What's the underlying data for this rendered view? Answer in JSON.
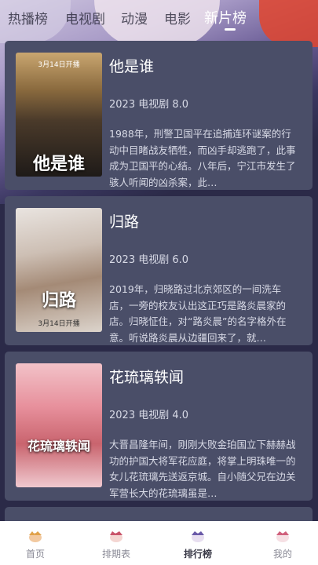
{
  "tabs": [
    {
      "label": "热播榜"
    },
    {
      "label": "电视剧"
    },
    {
      "label": "动漫"
    },
    {
      "label": "电影"
    },
    {
      "label": "新片榜",
      "active": true
    }
  ],
  "items": [
    {
      "title": "他是谁",
      "meta": "2023 电视剧 8.0",
      "desc": "1988年，刑警卫国平在追捕连环谜案的行动中目睹战友牺牲，而凶手却逃跑了，此事成为卫国平的心结。八年后，宁江市发生了骇人听闻的凶杀案，此…",
      "poster_title": "他是谁",
      "poster_date": "3月14日开播"
    },
    {
      "title": "归路",
      "meta": "2023 电视剧 6.0",
      "desc": "2019年，归晓路过北京郊区的一间洗车店，一旁的校友认出这正巧是路炎晨家的店。归晓怔住，对“路炎晨”的名字格外在意。听说路炎晨从边疆回来了，就…",
      "poster_title": "归路",
      "poster_date": "3月14日开播"
    },
    {
      "title": "花琉璃轶闻",
      "meta": "2023 电视剧 4.0",
      "desc": "大晋昌隆年间，刚刚大败金珀国立下赫赫战功的护国大将军花应庭，将掌上明珠唯一的女儿花琉璃先送返京城。自小随父兄在边关军营长大的花琉璃虽是…",
      "poster_title": "花琉璃轶闻",
      "poster_date": ""
    }
  ],
  "nav": [
    {
      "label": "首页",
      "icon": "home-icon"
    },
    {
      "label": "排期表",
      "icon": "schedule-icon"
    },
    {
      "label": "排行榜",
      "icon": "ranking-icon",
      "active": true
    },
    {
      "label": "我的",
      "icon": "profile-icon"
    }
  ]
}
